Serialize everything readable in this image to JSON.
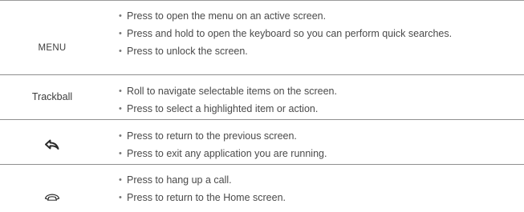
{
  "rows": [
    {
      "key": "MENU",
      "actions": [
        "Press to open the menu on an active screen.",
        "Press and hold to open the keyboard so you can perform quick searches.",
        "Press to unlock the screen."
      ]
    },
    {
      "key": "Trackball",
      "actions": [
        "Roll to navigate selectable items on the screen.",
        "Press to select a highlighted item or action."
      ]
    },
    {
      "key_icon": "back-arrow-icon",
      "actions": [
        "Press to return to the previous screen.",
        "Press to exit any application you are running."
      ]
    },
    {
      "key_icon": "end-call-icon",
      "actions": [
        "Press to hang up a call.",
        "Press to return to the Home screen."
      ]
    }
  ]
}
